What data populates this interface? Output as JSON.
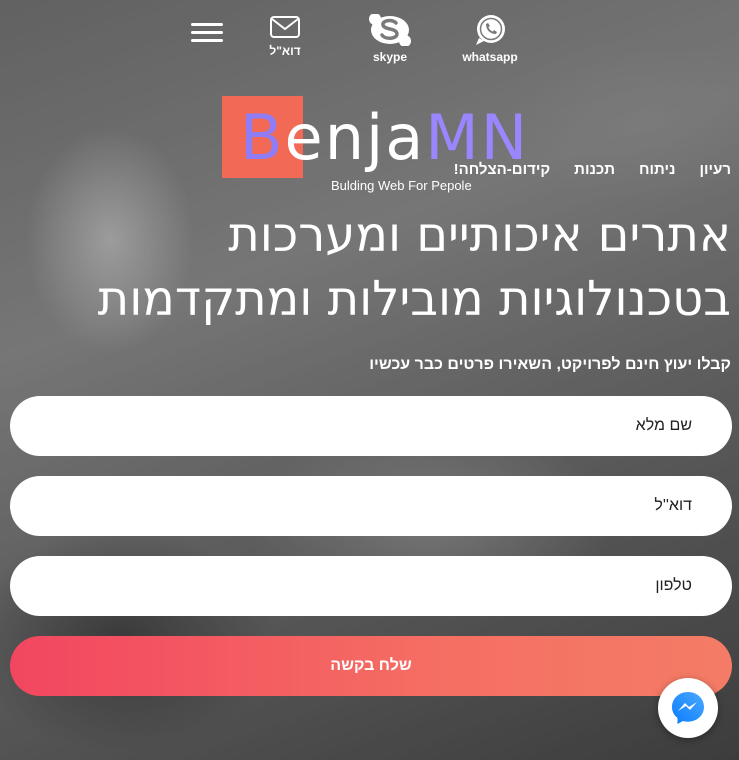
{
  "header": {
    "menu_icon": "hamburger-menu-icon",
    "contacts": [
      {
        "label": "דוא\"ל",
        "icon": "envelope-icon"
      },
      {
        "label": "skype",
        "icon": "skype-icon"
      },
      {
        "label": "whatsapp",
        "icon": "whatsapp-icon"
      }
    ]
  },
  "logo": {
    "letter": "B",
    "middle": "enja",
    "suffix": "MN",
    "tagline": "Bulding Web For Pepole",
    "colors": {
      "box": "#f26a55",
      "letter": "#8f7cf7",
      "suffix": "#9b86ff"
    }
  },
  "nav": {
    "items": [
      "רעיון",
      "ניתוח",
      "תכנות",
      "קידום-הצלחה!"
    ]
  },
  "hero": {
    "line1": "אתרים איכותיים ומערכות",
    "line2": "בטכנולוגיות מובילות ומתקדמות",
    "subtitle": "קבלו יעוץ חינם לפרויקט, השאירו פרטים כבר עכשיו"
  },
  "form": {
    "name_placeholder": "שם מלא",
    "email_placeholder": "דוא''ל",
    "phone_placeholder": "טלפון",
    "submit_label": "שלח בקשה",
    "submit_color": "#f24660"
  },
  "chat": {
    "icon": "messenger-icon"
  }
}
